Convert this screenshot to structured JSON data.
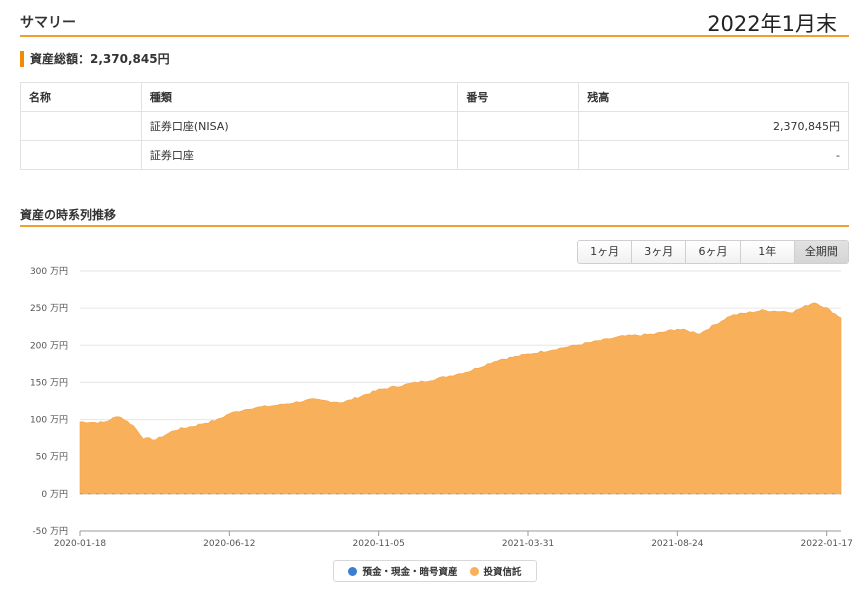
{
  "summary": {
    "title": "サマリー",
    "date_label": "2022年1月末",
    "total_assets": "資産総額：2,370,845円"
  },
  "table": {
    "headers": [
      "名称",
      "種類",
      "番号",
      "残高"
    ],
    "rows": [
      [
        "",
        "証券口座(NISA)",
        "",
        "2,370,845円"
      ],
      [
        "",
        "証券口座",
        "",
        "-"
      ]
    ]
  },
  "trend": {
    "title": "資産の時系列推移",
    "ranges": [
      "1ヶ月",
      "3ヶ月",
      "6ヶ月",
      "1年",
      "全期間"
    ],
    "active_range": "全期間"
  },
  "legend": {
    "items": [
      {
        "label": "預金・現金・暗号資産",
        "color": "#3a7fd5"
      },
      {
        "label": "投資信託",
        "color": "#f9b05a"
      }
    ]
  },
  "chart_data": {
    "type": "area",
    "y_unit": "万円",
    "ylim": [
      -50,
      300
    ],
    "y_ticks": [
      "300 万円",
      "250 万円",
      "200 万円",
      "150 万円",
      "100 万円",
      "50 万円",
      "0 万円",
      "-50 万円"
    ],
    "y_tick_values": [
      300,
      250,
      200,
      150,
      100,
      50,
      0,
      -50
    ],
    "x_tick_labels": [
      "2020-01-18",
      "2020-06-12",
      "2020-11-05",
      "2021-03-31",
      "2021-08-24",
      "2022-01-17"
    ],
    "xlim": [
      "2020-01-18",
      "2022-01-31"
    ],
    "grid": true,
    "legend_position": "bottom",
    "series": [
      {
        "name": "投資信託",
        "color": "#f9b05a",
        "x": [
          "2020-01-18",
          "2020-02-10",
          "2020-02-25",
          "2020-03-10",
          "2020-03-20",
          "2020-04-01",
          "2020-04-20",
          "2020-05-10",
          "2020-06-01",
          "2020-06-12",
          "2020-07-01",
          "2020-08-01",
          "2020-09-01",
          "2020-10-01",
          "2020-11-05",
          "2020-12-01",
          "2021-01-01",
          "2021-02-01",
          "2021-03-01",
          "2021-03-31",
          "2021-05-01",
          "2021-06-01",
          "2021-07-01",
          "2021-08-01",
          "2021-08-24",
          "2021-09-15",
          "2021-10-15",
          "2021-11-15",
          "2021-12-15",
          "2022-01-05",
          "2022-01-17",
          "2022-01-31"
        ],
        "values": [
          97,
          96,
          105,
          92,
          75,
          73,
          86,
          92,
          100,
          108,
          115,
          120,
          127,
          123,
          140,
          147,
          155,
          165,
          180,
          188,
          196,
          204,
          212,
          215,
          222,
          216,
          240,
          247,
          245,
          258,
          250,
          237
        ]
      },
      {
        "name": "預金・現金・暗号資産",
        "color": "#3a7fd5",
        "x": [
          "2020-01-18",
          "2022-01-31"
        ],
        "values": [
          0,
          0
        ]
      }
    ]
  }
}
